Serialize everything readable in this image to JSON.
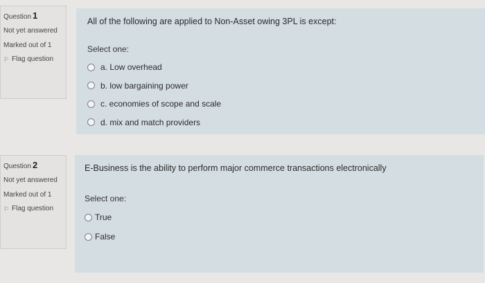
{
  "questions": [
    {
      "label": "Question",
      "number": "1",
      "state": "Not yet answered",
      "marks": "Marked out of 1",
      "flag": "Flag question",
      "text": "All of the following are applied to Non-Asset owing 3PL is except:",
      "prompt": "Select one:",
      "options": [
        "a. Low overhead",
        "b. low bargaining power",
        "c. economies of scope and scale",
        "d. mix and match providers"
      ]
    },
    {
      "label": "Question",
      "number": "2",
      "state": "Not yet answered",
      "marks": "Marked out of 1",
      "flag": "Flag question",
      "text": "E-Business is the ability to perform major commerce transactions electronically",
      "prompt": "Select one:",
      "options": [
        "True",
        "False"
      ]
    }
  ]
}
